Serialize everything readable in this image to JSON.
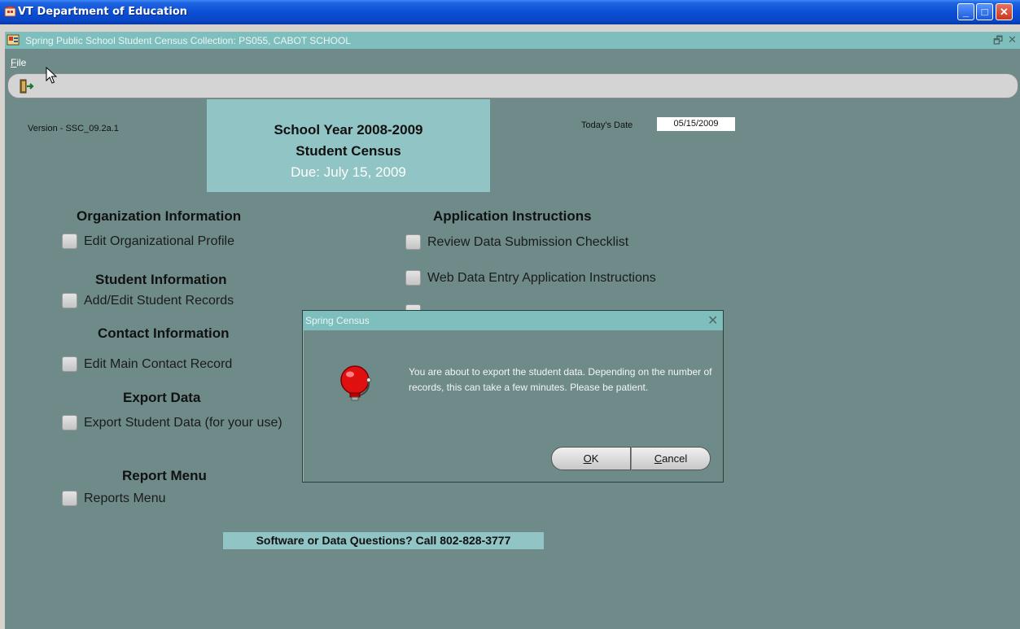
{
  "window": {
    "title": "VT Department of Education",
    "min_glyph": "_",
    "max_glyph": "□",
    "close_glyph": "✕"
  },
  "mdi": {
    "title": "Spring Public School Student Census Collection: PS055, CABOT SCHOOL",
    "restore_glyph": "🗗",
    "close_glyph": "✕"
  },
  "menu": {
    "file_mnemonic": "F",
    "file_rest": "ile"
  },
  "header": {
    "version": "Version - SSC_09.2a.1",
    "banner_line1": "School Year 2008-2009",
    "banner_line2": "Student Census",
    "banner_line3": "Due:  July 15, 2009",
    "date_label": "Today's Date",
    "date_value": "05/15/2009"
  },
  "sections": {
    "org_heading": "Organization Information",
    "org_option": "Edit Organizational Profile",
    "student_heading": "Student Information",
    "student_option": "Add/Edit Student Records",
    "contact_heading": "Contact Information",
    "contact_option": "Edit Main Contact Record",
    "export_heading": "Export Data",
    "export_option": "Export Student Data (for your use)",
    "report_heading": "Report Menu",
    "report_option": "Reports Menu",
    "app_heading": "Application Instructions",
    "app_option1": "Review Data Submission Checklist",
    "app_option2": "Web Data Entry Application Instructions"
  },
  "footer": {
    "help": "Software or Data Questions?  Call 802-828-3777"
  },
  "dialog": {
    "title": "Spring Census",
    "close_glyph": "✕",
    "message": "You are about to export the student data. Depending on the number of records, this can take a few minutes. Please be patient.",
    "ok_mnemonic": "O",
    "ok_rest": "K",
    "cancel_mnemonic": "C",
    "cancel_rest": "ancel"
  },
  "colors": {
    "app_background": "#6e8b8a",
    "banner": "#91c4c4",
    "title_teal": "#7ebfbd"
  }
}
